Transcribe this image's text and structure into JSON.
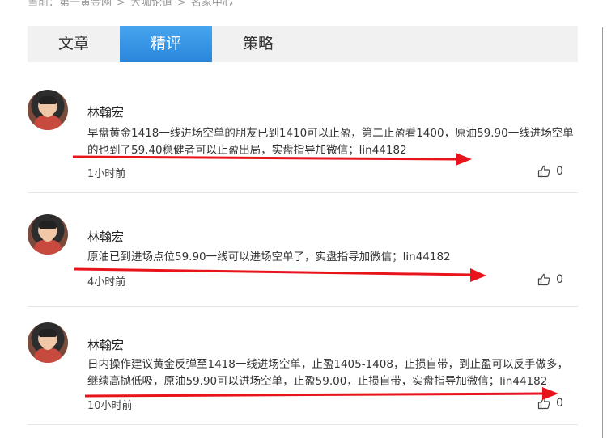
{
  "breadcrumb": {
    "prefix": "当前：",
    "items": [
      "第一黄金网",
      "大咖论道",
      "名家中心"
    ],
    "separator": ">"
  },
  "tabs": [
    {
      "label": "文章",
      "active": false
    },
    {
      "label": "精评",
      "active": true
    },
    {
      "label": "策略",
      "active": false
    }
  ],
  "colors": {
    "accent": "#2a86dc",
    "annotation": "#e8131b"
  },
  "posts": [
    {
      "author": "林翰宏",
      "content": "早盘黄金1418一线进场空单的朋友已到1410可以止盈，第二止盈看1400，原油59.90一线进场空单的也到了59.40稳健者可以止盈出局，实盘指导加微信；lin44182",
      "time": "1小时前",
      "likes": "0"
    },
    {
      "author": "林翰宏",
      "content": "原油已到进场点位59.90一线可以进场空单了，实盘指导加微信；lin44182",
      "time": "4小时前",
      "likes": "0"
    },
    {
      "author": "林翰宏",
      "content": "日内操作建议黄金反弹至1418一线进场空单，止盈1405-1408，止损自带，到止盈可以反手做多，继续高抛低吸，原油59.90可以进场空单，止盈59.00，止损自带，实盘指导加微信；lin44182",
      "time": "10小时前",
      "likes": "0"
    }
  ],
  "icons": {
    "like": "thumbs-up-icon"
  }
}
